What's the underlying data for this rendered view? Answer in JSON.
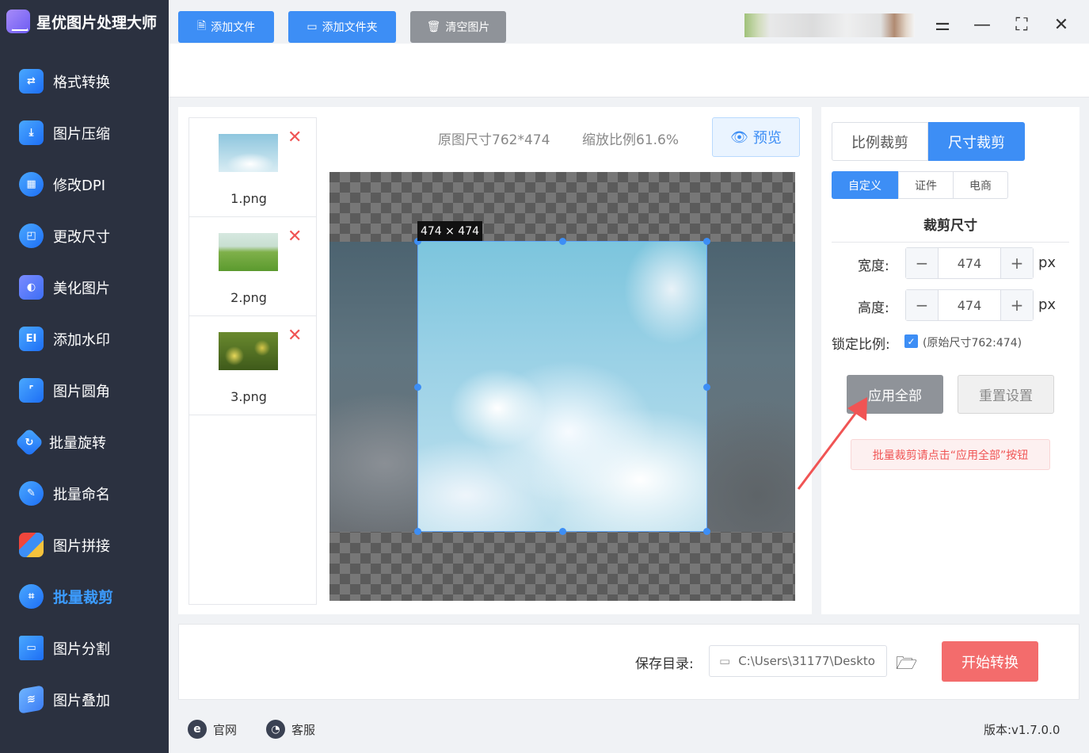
{
  "app": {
    "title": "星优图片处理大师"
  },
  "sidebar": {
    "items": [
      {
        "label": "格式转换",
        "icon": "image-convert-icon"
      },
      {
        "label": "图片压缩",
        "icon": "compress-icon"
      },
      {
        "label": "修改DPI",
        "icon": "dpi-icon"
      },
      {
        "label": "更改尺寸",
        "icon": "resize-icon"
      },
      {
        "label": "美化图片",
        "icon": "beautify-icon"
      },
      {
        "label": "添加水印",
        "icon": "watermark-icon"
      },
      {
        "label": "图片圆角",
        "icon": "round-corner-icon"
      },
      {
        "label": "批量旋转",
        "icon": "rotate-icon"
      },
      {
        "label": "批量命名",
        "icon": "rename-icon"
      },
      {
        "label": "图片拼接",
        "icon": "puzzle-icon"
      },
      {
        "label": "批量裁剪",
        "icon": "crop-icon",
        "active": true
      },
      {
        "label": "图片分割",
        "icon": "split-icon"
      },
      {
        "label": "图片叠加",
        "icon": "layers-icon"
      }
    ]
  },
  "toolbar": {
    "add_file": "添加文件",
    "add_folder": "添加文件夹",
    "clear": "清空图片"
  },
  "files": [
    {
      "name": "1.png"
    },
    {
      "name": "2.png"
    },
    {
      "name": "3.png"
    }
  ],
  "preview": {
    "original_size": "原图尺寸762*474",
    "zoom": "缩放比例61.6%",
    "button": "预览",
    "crop_badge": "474 × 474"
  },
  "settings": {
    "tabs": [
      "比例裁剪",
      "尺寸裁剪"
    ],
    "active_tab": "尺寸裁剪",
    "subtabs": [
      "自定义",
      "证件",
      "电商"
    ],
    "active_subtab": "自定义",
    "section_title": "裁剪尺寸",
    "width_label": "宽度:",
    "width_value": "474",
    "height_label": "高度:",
    "height_value": "474",
    "unit": "px",
    "lock_label": "锁定比例:",
    "lock_hint": "(原始尺寸762:474)",
    "lock_checked": true,
    "apply_all": "应用全部",
    "reset": "重置设置",
    "hint": "批量裁剪请点击“应用全部”按钮"
  },
  "output": {
    "label": "保存目录:",
    "path": "C:\\Users\\31177\\Deskto",
    "start": "开始转换"
  },
  "footer": {
    "website": "官网",
    "support": "客服",
    "version": "版本:v1.7.0.0"
  },
  "colors": {
    "accent": "#3d8ef5",
    "sidebar_bg": "#2b3140",
    "start_button": "#f36c6c",
    "gray_button": "#8f9399"
  }
}
